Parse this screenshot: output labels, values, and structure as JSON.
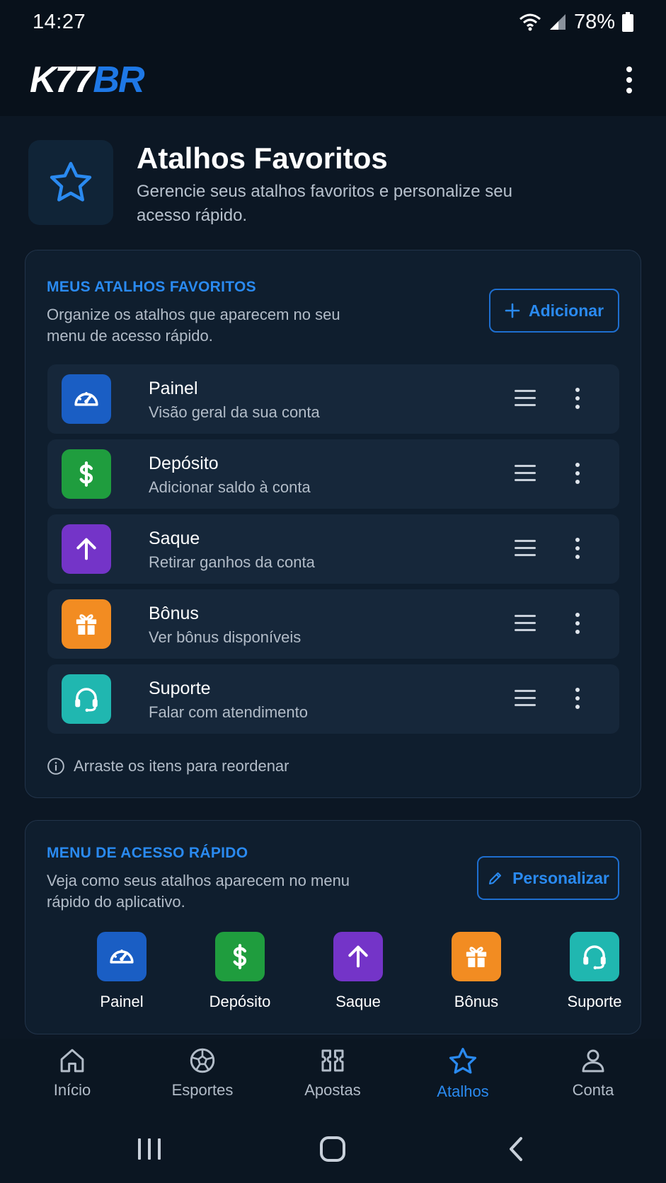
{
  "status_bar": {
    "time": "14:27",
    "battery": "78%"
  },
  "header": {
    "logo_white": "K77",
    "logo_blue": "BR"
  },
  "page": {
    "title": "Atalhos Favoritos",
    "subtitle": "Gerencie seus atalhos favoritos e personalize seu acesso rápido."
  },
  "favorites": {
    "title": "MEUS ATALHOS FAVORITOS",
    "description": "Organize os atalhos que aparecem no seu menu de acesso rápido.",
    "add_label": "Adicionar",
    "items": [
      {
        "title": "Painel",
        "subtitle": "Visão geral da sua conta",
        "icon": "speedometer-icon",
        "color": "#1a5ec4"
      },
      {
        "title": "Depósito",
        "subtitle": "Adicionar saldo à conta",
        "icon": "dollar-icon",
        "color": "#1f9d3e"
      },
      {
        "title": "Saque",
        "subtitle": "Retirar ganhos da conta",
        "icon": "arrow-up-icon",
        "color": "#7434c8"
      },
      {
        "title": "Bônus",
        "subtitle": "Ver bônus disponíveis",
        "icon": "gift-icon",
        "color": "#f28c22"
      },
      {
        "title": "Suporte",
        "subtitle": "Falar com atendimento",
        "icon": "headset-icon",
        "color": "#20b7b0"
      }
    ],
    "hint": "Arraste os itens para reordenar"
  },
  "quick_menu": {
    "title": "MENU DE ACESSO RÁPIDO",
    "description": "Veja como seus atalhos aparecem no menu rápido do aplicativo.",
    "customize_label": "Personalizar",
    "items": [
      {
        "label": "Painel",
        "icon": "speedometer-icon"
      },
      {
        "label": "Depósito",
        "icon": "dollar-icon"
      },
      {
        "label": "Saque",
        "icon": "arrow-up-icon"
      },
      {
        "label": "Bônus",
        "icon": "gift-icon"
      },
      {
        "label": "Suporte",
        "icon": "headset-icon"
      }
    ]
  },
  "bottom_nav": {
    "active": "Atalhos",
    "items": [
      {
        "label": "Início",
        "icon": "home-icon"
      },
      {
        "label": "Esportes",
        "icon": "soccer-ball-icon"
      },
      {
        "label": "Apostas",
        "icon": "tickets-icon"
      },
      {
        "label": "Atalhos",
        "icon": "star-icon"
      },
      {
        "label": "Conta",
        "icon": "user-icon"
      }
    ]
  },
  "colors": {
    "accent": "#2a8af0",
    "background": "#0c1724",
    "card": "#0f1e2e"
  }
}
